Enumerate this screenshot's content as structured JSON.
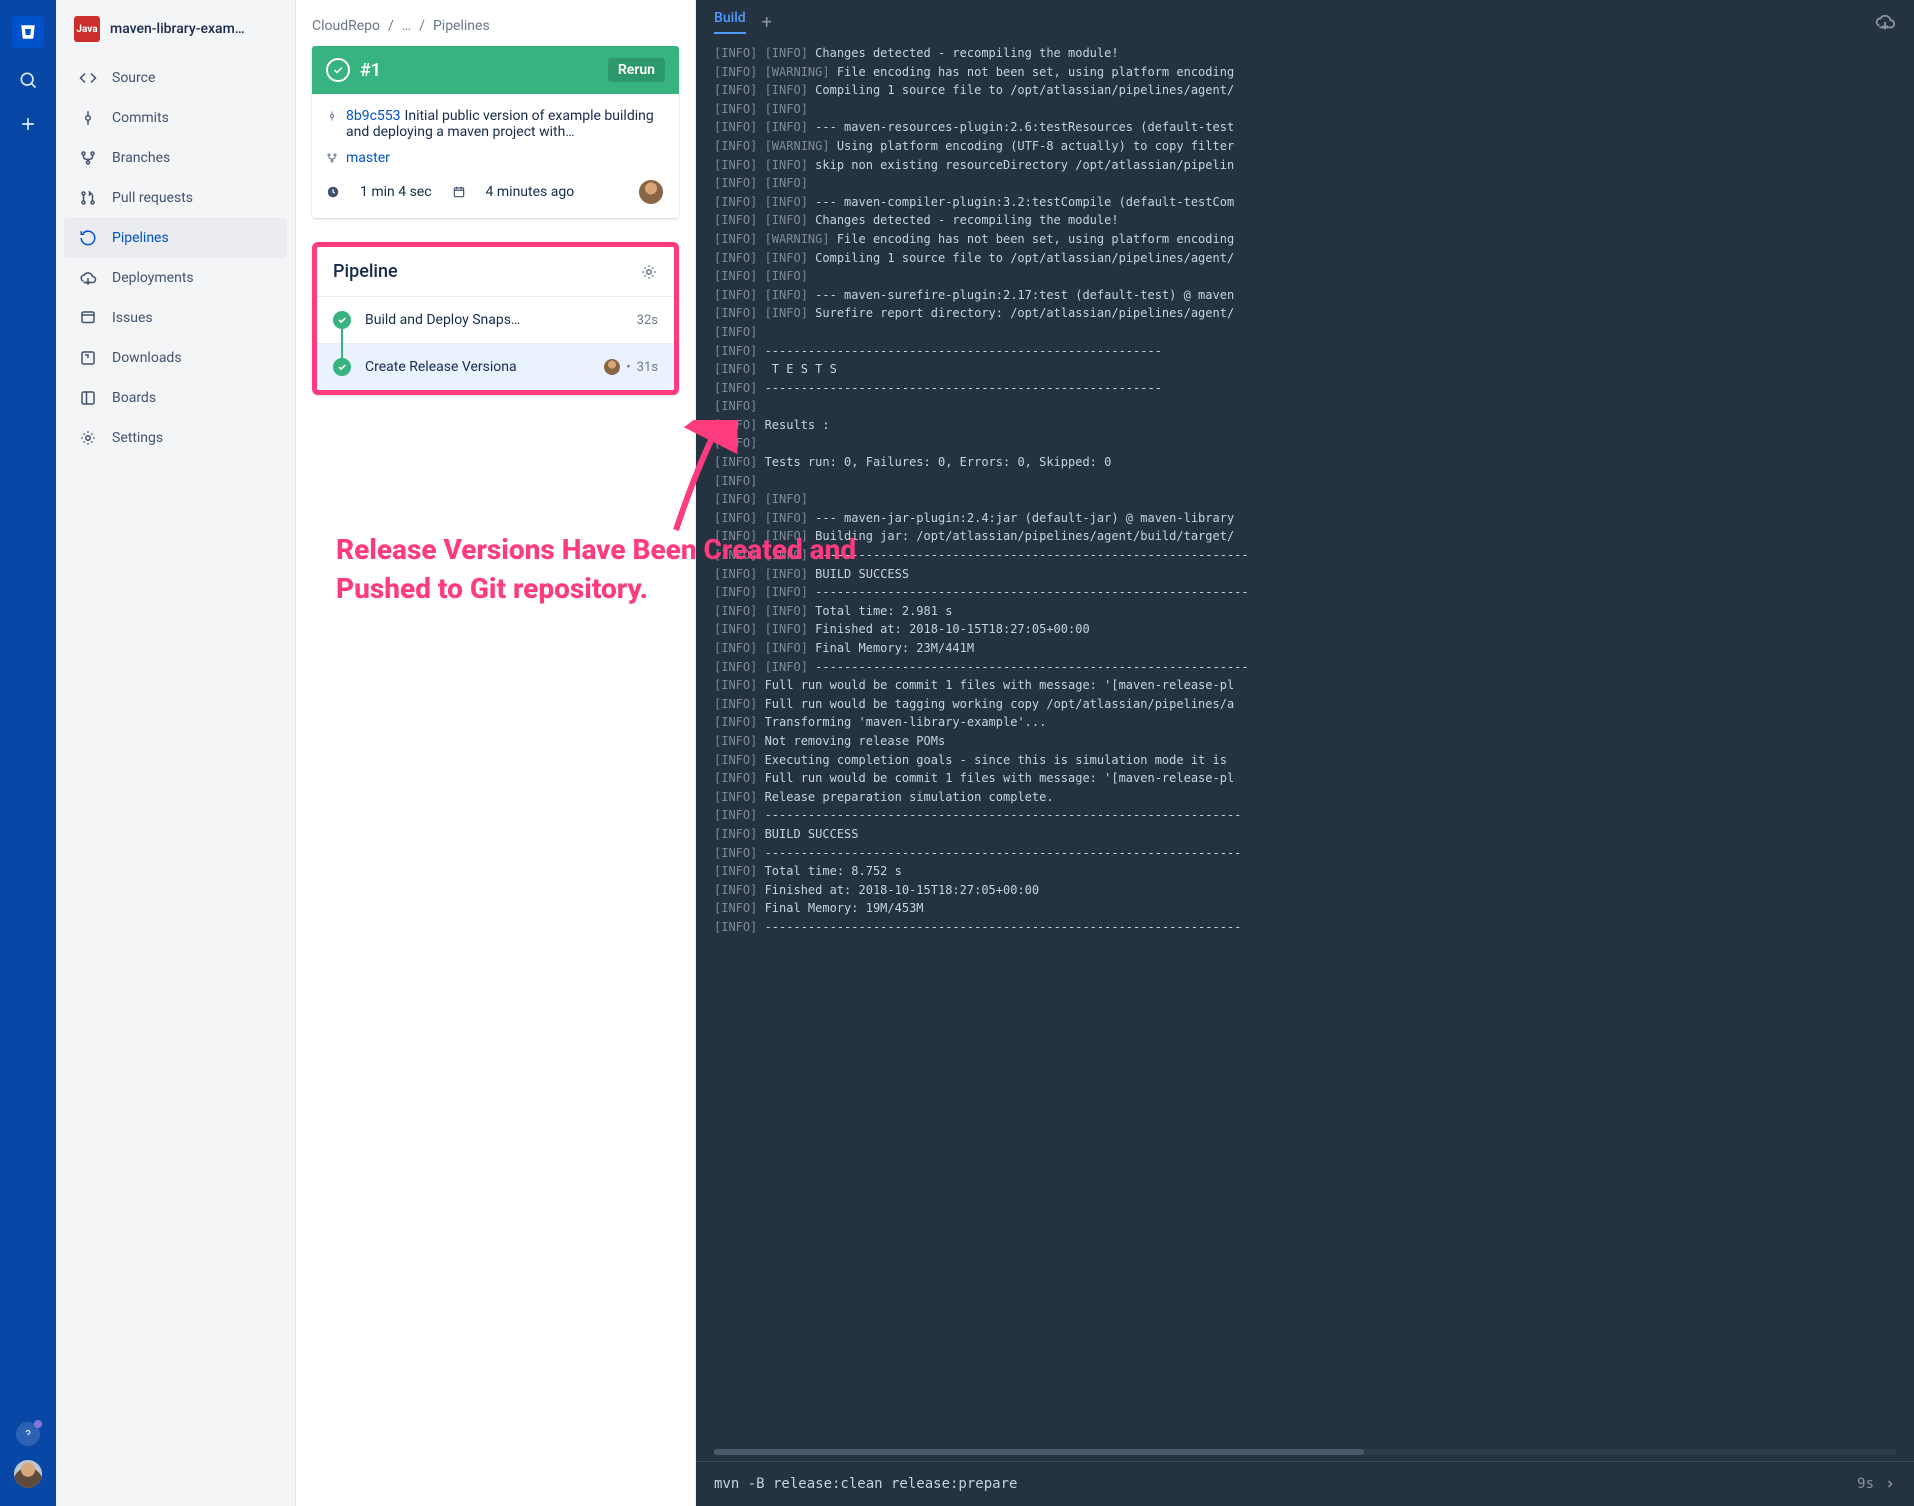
{
  "project": {
    "badge": "Java",
    "name": "maven-library-exam…"
  },
  "sidebar": {
    "items": [
      {
        "label": "Source"
      },
      {
        "label": "Commits"
      },
      {
        "label": "Branches"
      },
      {
        "label": "Pull requests"
      },
      {
        "label": "Pipelines"
      },
      {
        "label": "Deployments"
      },
      {
        "label": "Issues"
      },
      {
        "label": "Downloads"
      },
      {
        "label": "Boards"
      },
      {
        "label": "Settings"
      }
    ]
  },
  "breadcrumb": {
    "a": "CloudRepo",
    "b": "…",
    "c": "Pipelines"
  },
  "run": {
    "title": "#1",
    "rerun": "Rerun",
    "commit_hash": "8b9c553",
    "commit_msg": "Initial public version of example building and deploying a maven project with…",
    "branch": "master",
    "duration": "1 min 4 sec",
    "when": "4 minutes ago"
  },
  "pipeline": {
    "title": "Pipeline",
    "steps": [
      {
        "name": "Build and Deploy Snaps…",
        "dur": "32s"
      },
      {
        "name": "Create Release Versiona",
        "dur": "31s"
      }
    ]
  },
  "annotation": "Release Versions Have Been Created and Pushed to Git repository.",
  "log": {
    "tab": "Build",
    "cmd": "mvn -B release:clean release:prepare",
    "cmddur": "9s",
    "lines": [
      "[INFO] [INFO] Changes detected - recompiling the module!",
      "[INFO] [WARNING] File encoding has not been set, using platform encoding",
      "[INFO] [INFO] Compiling 1 source file to /opt/atlassian/pipelines/agent/",
      "[INFO] [INFO]",
      "[INFO] [INFO] --- maven-resources-plugin:2.6:testResources (default-test",
      "[INFO] [WARNING] Using platform encoding (UTF-8 actually) to copy filter",
      "[INFO] [INFO] skip non existing resourceDirectory /opt/atlassian/pipelin",
      "[INFO] [INFO]",
      "[INFO] [INFO] --- maven-compiler-plugin:3.2:testCompile (default-testCom",
      "[INFO] [INFO] Changes detected - recompiling the module!",
      "[INFO] [WARNING] File encoding has not been set, using platform encoding",
      "[INFO] [INFO] Compiling 1 source file to /opt/atlassian/pipelines/agent/",
      "[INFO] [INFO]",
      "[INFO] [INFO] --- maven-surefire-plugin:2.17:test (default-test) @ maven",
      "[INFO] [INFO] Surefire report directory: /opt/atlassian/pipelines/agent/",
      "[INFO]",
      "[INFO] -------------------------------------------------------",
      "[INFO]  T E S T S",
      "[INFO] -------------------------------------------------------",
      "[INFO]",
      "[INFO] Results :",
      "[INFO]",
      "[INFO] Tests run: 0, Failures: 0, Errors: 0, Skipped: 0",
      "[INFO]",
      "[INFO] [INFO]",
      "[INFO] [INFO] --- maven-jar-plugin:2.4:jar (default-jar) @ maven-library",
      "[INFO] [INFO] Building jar: /opt/atlassian/pipelines/agent/build/target/",
      "[INFO] [INFO] ------------------------------------------------------------",
      "[INFO] [INFO] BUILD SUCCESS",
      "[INFO] [INFO] ------------------------------------------------------------",
      "[INFO] [INFO] Total time: 2.981 s",
      "[INFO] [INFO] Finished at: 2018-10-15T18:27:05+00:00",
      "[INFO] [INFO] Final Memory: 23M/441M",
      "[INFO] [INFO] ------------------------------------------------------------",
      "[INFO] Full run would be commit 1 files with message: '[maven-release-pl",
      "[INFO] Full run would be tagging working copy /opt/atlassian/pipelines/a",
      "[INFO] Transforming 'maven-library-example'...",
      "[INFO] Not removing release POMs",
      "[INFO] Executing completion goals - since this is simulation mode it is",
      "[INFO] Full run would be commit 1 files with message: '[maven-release-pl",
      "[INFO] Release preparation simulation complete.",
      "[INFO] ------------------------------------------------------------------",
      "[INFO] BUILD SUCCESS",
      "[INFO] ------------------------------------------------------------------",
      "[INFO] Total time: 8.752 s",
      "[INFO] Finished at: 2018-10-15T18:27:05+00:00",
      "[INFO] Final Memory: 19M/453M",
      "[INFO] ------------------------------------------------------------------"
    ]
  }
}
